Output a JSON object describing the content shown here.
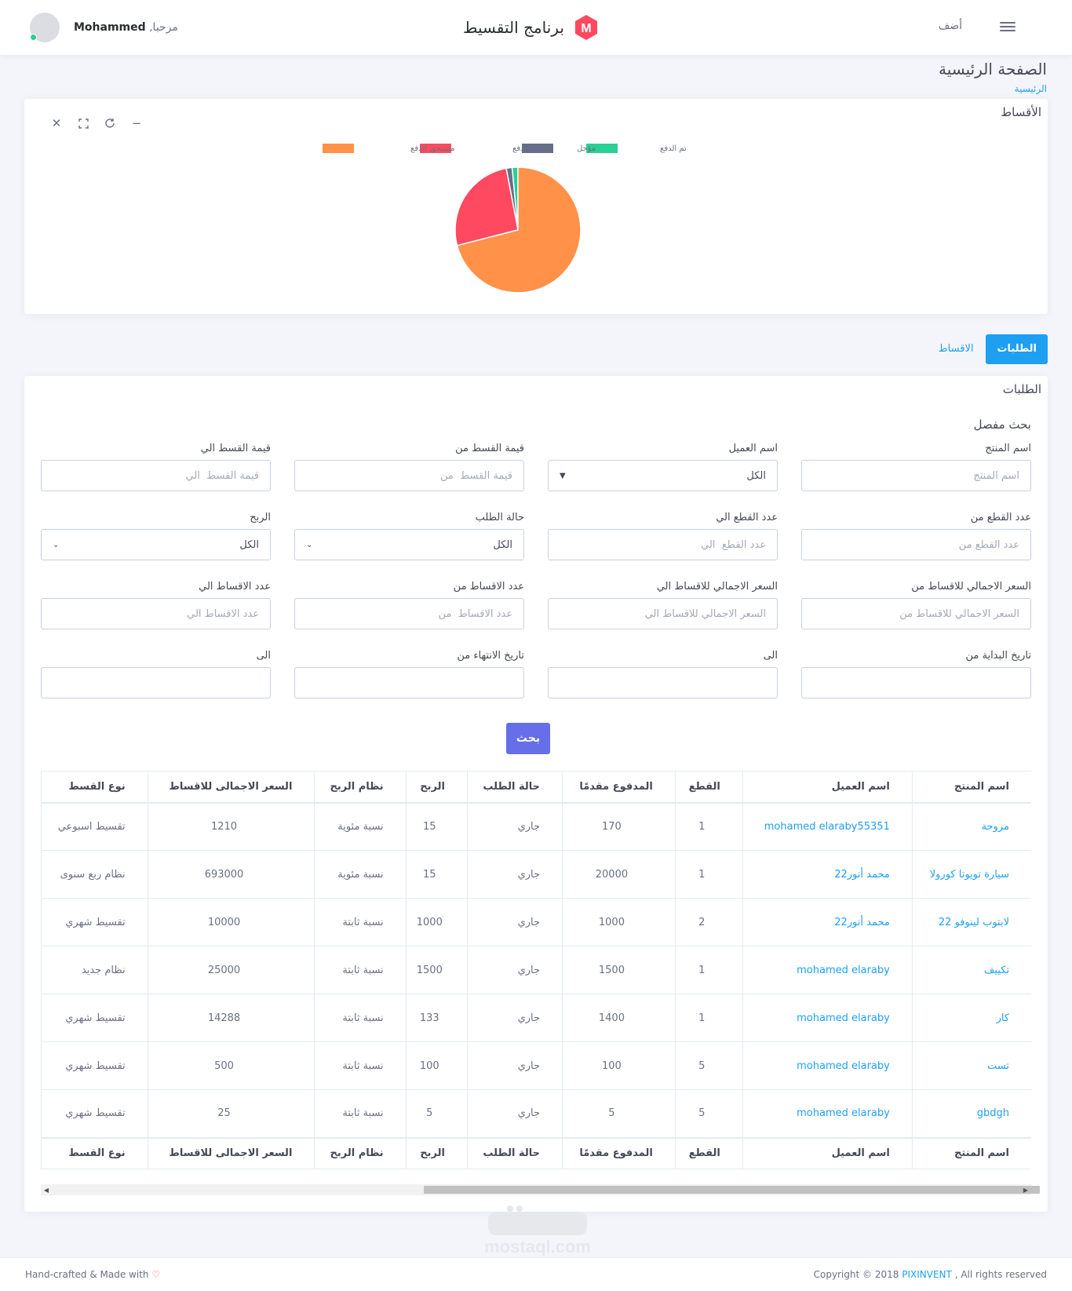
{
  "navbar": {
    "add_label": "أضف",
    "brand_letter": "M",
    "brand_title": "برنامج التقسيط",
    "greeting": "مرحبا,",
    "user_name": "Mohammed"
  },
  "page": {
    "title": "الصفحة الرئيسية",
    "breadcrumb": "الرئيسية"
  },
  "chart_card": {
    "title": "الأقساط",
    "tools": [
      "minus-icon",
      "refresh-icon",
      "expand-icon",
      "close-icon"
    ]
  },
  "chart_data": {
    "type": "pie",
    "legend_position": "top",
    "series": [
      {
        "name": "تم الدفع",
        "value": 1.5,
        "color": "#28d094"
      },
      {
        "name": "مؤجل",
        "value": 1.5,
        "color": "#666e8a"
      },
      {
        "name": "لم يتم الدفع",
        "value": 26,
        "color": "#ff4961"
      },
      {
        "name": "مستحق الدفع",
        "value": 71,
        "color": "#ff9149"
      }
    ]
  },
  "tabs": [
    {
      "label": "الطلبات",
      "active": true
    },
    {
      "label": "الاقساط",
      "active": false
    }
  ],
  "orders_card": {
    "title": "الطلبات",
    "search_title": "بحث مفصل",
    "search_button": "بحث"
  },
  "filters": {
    "product_name": {
      "label": "اسم المنتج",
      "placeholder": "اسم المنتج"
    },
    "customer_name": {
      "label": "اسم العميل",
      "value": "الكل"
    },
    "installment_value_from": {
      "label": "قيمة القسط من",
      "placeholder": "قيمة القسط  من"
    },
    "installment_value_to": {
      "label": "قيمة القسط الي",
      "placeholder": "قيمة القسط  الي"
    },
    "pieces_from": {
      "label": "عدد القطع من",
      "placeholder": "عدد القطع من"
    },
    "pieces_to": {
      "label": "عدد القطع الي",
      "placeholder": "عدد القطع  الي"
    },
    "order_status": {
      "label": "حالة الطلب",
      "value": "الكل"
    },
    "profit": {
      "label": "الربح",
      "value": "الكل"
    },
    "total_from": {
      "label": "السعر الاجمالي للاقساط من",
      "placeholder": "السعر الاجمالي للاقساط من"
    },
    "total_to": {
      "label": "السعر الاجمالي للاقساط الي",
      "placeholder": "السعر الاجمالي للاقساط الي"
    },
    "count_from": {
      "label": "عدد الاقساط من",
      "placeholder": "عدد الاقساط  من"
    },
    "count_to": {
      "label": "عدد الاقساط الي",
      "placeholder": "عدد الاقساط الي"
    },
    "start_from": {
      "label": "تاريخ البداية من"
    },
    "start_to": {
      "label": "الى"
    },
    "end_from": {
      "label": "تاريخ الانتهاء من"
    },
    "end_to": {
      "label": "الى"
    }
  },
  "table": {
    "columns": [
      "اسم المنتج",
      "اسم العميل",
      "القطع",
      "المدفوع مقدمًا",
      "حالة الطلب",
      "الربح",
      "نظام الربح",
      "السعر الاجمالى للاقساط",
      "نوع القسط"
    ],
    "rows": [
      [
        "مروحة",
        "mohamed elaraby55351",
        "1",
        "170",
        "جاري",
        "15",
        "نسبة مئوية",
        "1210",
        "تقسيط اسبوعي"
      ],
      [
        "سيارة تويوتا كورولا",
        "محمد أنور22",
        "1",
        "20000",
        "جاري",
        "15",
        "نسبة مئوية",
        "693000",
        "نظام ربع سنوى"
      ],
      [
        "لابتوب لينوفو 22",
        "محمد أنور22",
        "2",
        "1000",
        "جاري",
        "1000",
        "نسبة ثابتة",
        "10000",
        "تقسيط شهري"
      ],
      [
        "تكييف",
        "mohamed elaraby",
        "1",
        "1500",
        "جاري",
        "1500",
        "نسبة ثابتة",
        "25000",
        "نظام جديد"
      ],
      [
        "كار",
        "mohamed elaraby",
        "1",
        "1400",
        "جاري",
        "133",
        "نسبة ثابتة",
        "14288",
        "تقسيط شهري"
      ],
      [
        "تست",
        "mohamed elaraby",
        "5",
        "100",
        "جاري",
        "100",
        "نسبة ثابتة",
        "500",
        "تقسيط شهري"
      ],
      [
        "gbdgh",
        "mohamed elaraby",
        "5",
        "5",
        "جاري",
        "5",
        "نسبة ثابتة",
        "25",
        "تقسيط شهري"
      ]
    ]
  },
  "watermark": "mostaql.com",
  "footer": {
    "left": "Hand-crafted & Made with",
    "copyright_prefix": "Copyright © 2018",
    "brand": "PIXINVENT",
    "copyright_suffix": ", All rights reserved"
  }
}
